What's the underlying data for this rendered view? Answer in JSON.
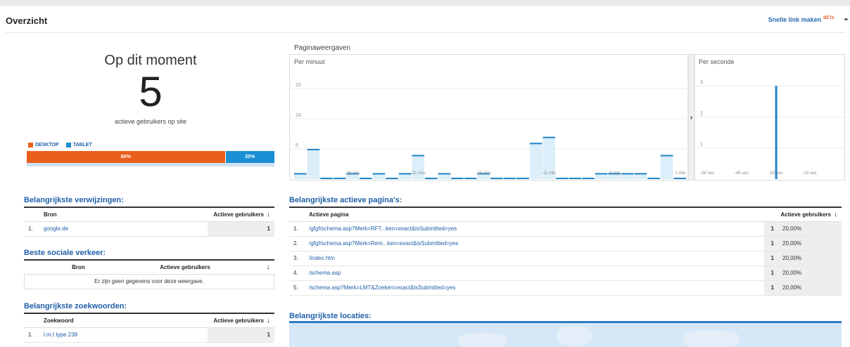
{
  "header": {
    "title": "Overzicht",
    "quick_link": "Snelle link maken",
    "beta": "BÈTA"
  },
  "realtime": {
    "title": "Op dit moment",
    "count": "5",
    "subtitle": "actieve gebruikers op site",
    "legend": [
      {
        "label": "DESKTOP",
        "color": "#e8601c"
      },
      {
        "label": "TABLET",
        "color": "#1b8fd4"
      }
    ],
    "devices": [
      {
        "label": "80%",
        "fraction": 0.8,
        "color": "#e8601c"
      },
      {
        "label": "20%",
        "fraction": 0.2,
        "color": "#1b8fd4"
      }
    ]
  },
  "pageviews": {
    "title": "Paginaweergaven",
    "per_minute_label": "Per minuut",
    "per_second_label": "Per seconde",
    "toggle_icon": "chevron-right-icon"
  },
  "chart_data": [
    {
      "type": "bar",
      "title": "Per minuut",
      "yticks": [
        5,
        10,
        15
      ],
      "ylim": [
        0,
        18
      ],
      "xticks": [
        "-26 min.",
        "-21 min.",
        "-16 min.",
        "-11 min.",
        "-6 min.",
        "-1 min."
      ],
      "x": [
        -30,
        -29,
        -28,
        -27,
        -26,
        -25,
        -24,
        -23,
        -22,
        -21,
        -20,
        -19,
        -18,
        -17,
        -16,
        -15,
        -14,
        -13,
        -12,
        -11,
        -10,
        -9,
        -8,
        -7,
        -6,
        -5,
        -4,
        -3,
        -2,
        -1
      ],
      "values": [
        1,
        5,
        0,
        0,
        1,
        0,
        1,
        0,
        1,
        4,
        0,
        1,
        0,
        0,
        1,
        0,
        0,
        0,
        6,
        7,
        0,
        0,
        0,
        1,
        1,
        1,
        1,
        0,
        4,
        0
      ]
    },
    {
      "type": "bar",
      "title": "Per seconde",
      "yticks": [
        1,
        2,
        3
      ],
      "ylim": [
        0,
        3.5
      ],
      "xticks": [
        "-60 sec.",
        "-45 sec.",
        "-30 sec.",
        "-15 sec."
      ],
      "x": [
        -30
      ],
      "values": [
        3
      ]
    }
  ],
  "referrals": {
    "title": "Belangrijkste verwijzingen:",
    "columns": [
      "Bron",
      "Actieve gebruikers"
    ],
    "rows": [
      {
        "num": "1.",
        "source": "google.de",
        "users": "1"
      }
    ]
  },
  "social": {
    "title": "Beste sociale verkeer:",
    "columns": [
      "Bron",
      "Actieve gebruikers"
    ],
    "empty": "Er zijn geen gegevens voor deze weergave."
  },
  "keywords": {
    "title": "Belangrijkste zoekwoorden:",
    "columns": [
      "Zoekwoord",
      "Actieve gebruikers"
    ],
    "rows": [
      {
        "num": "1.",
        "keyword": "l.m.t type 238",
        "users": "1"
      }
    ]
  },
  "pages": {
    "title": "Belangrijkste actieve pagina's:",
    "columns": [
      "Actieve pagina",
      "Actieve gebruikers"
    ],
    "rows": [
      {
        "num": "1.",
        "page": "/gfgf/schema.asp?Merk=RFT...ken=exact&isSubmitted=yes",
        "users": "1",
        "pct": "20,00%"
      },
      {
        "num": "2.",
        "page": "/gfgf/schema.asp?Merk=Rem...ken=exact&isSubmitted=yes",
        "users": "1",
        "pct": "20,00%"
      },
      {
        "num": "3.",
        "page": "/index.htm",
        "users": "1",
        "pct": "20,00%"
      },
      {
        "num": "4.",
        "page": "/schema.asp",
        "users": "1",
        "pct": "20,00%"
      },
      {
        "num": "5.",
        "page": "/schema.asp?Merk=LMT&Zoeken=exact&isSubmitted=yes",
        "users": "1",
        "pct": "20,00%"
      }
    ]
  },
  "locations": {
    "title": "Belangrijkste locaties:"
  }
}
